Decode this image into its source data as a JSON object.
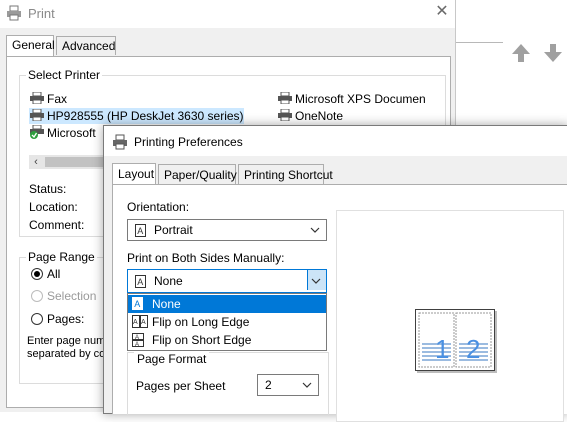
{
  "print_dialog": {
    "title": "Print",
    "close_symbol": "✕",
    "tabs": [
      {
        "label": "General"
      },
      {
        "label": "Advanced"
      }
    ],
    "select_printer_label": "Select Printer",
    "printers": [
      {
        "name": "Fax",
        "icon": "printer-icon"
      },
      {
        "name": "HP928555 (HP DeskJet 3630 series)",
        "icon": "printer-icon"
      },
      {
        "name": "Microsoft",
        "icon": "printer-default-icon"
      },
      {
        "name": "Microsoft XPS Documen",
        "icon": "printer-icon"
      },
      {
        "name": "OneNote",
        "icon": "printer-icon"
      }
    ],
    "status_label": "Status:",
    "location_label": "Location:",
    "comment_label": "Comment:",
    "page_range_label": "Page Range",
    "range_options": [
      {
        "label": "All",
        "checked": true
      },
      {
        "label": "Selection",
        "disabled": true
      },
      {
        "label": "Pages:"
      }
    ],
    "hint_line1": "Enter page num",
    "hint_line2": "separated by co"
  },
  "preferences_dialog": {
    "title": "Printing Preferences",
    "tabs": [
      {
        "label": "Layout"
      },
      {
        "label": "Paper/Quality"
      },
      {
        "label": "Printing Shortcut"
      }
    ],
    "orientation_label": "Orientation:",
    "orientation_value": "Portrait",
    "duplex_label": "Print on Both Sides Manually:",
    "duplex_value": "None",
    "duplex_options": [
      "None",
      "Flip on Long Edge",
      "Flip on Short Edge"
    ],
    "page_format_label": "Page Format",
    "pages_per_sheet_label": "Pages per Sheet",
    "pages_per_sheet_value": "2",
    "preview_pages": [
      "1",
      "2"
    ]
  },
  "colors": {
    "accent": "#0078d7",
    "selection": "#cce8ff",
    "preview_digits": "#4a90e2"
  }
}
